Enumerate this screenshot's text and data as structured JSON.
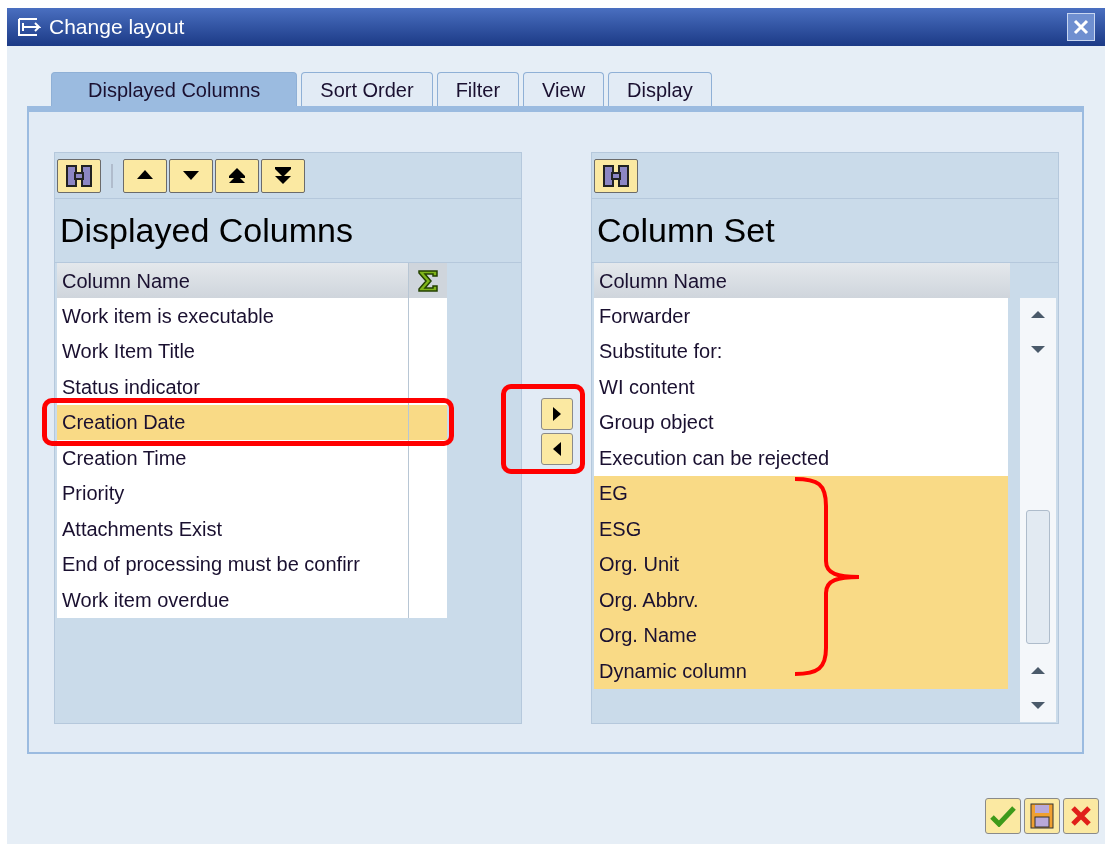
{
  "window": {
    "title": "Change layout"
  },
  "tabs": [
    {
      "label": "Displayed Columns",
      "selected": true
    },
    {
      "label": "Sort Order",
      "selected": false
    },
    {
      "label": "Filter",
      "selected": false
    },
    {
      "label": "View",
      "selected": false
    },
    {
      "label": "Display",
      "selected": false
    }
  ],
  "displayed_columns": {
    "title": "Displayed Columns",
    "header": "Column Name",
    "rows": [
      {
        "label": "Work item is executable",
        "selected": false
      },
      {
        "label": "Work Item Title",
        "selected": false
      },
      {
        "label": "Status indicator",
        "selected": false
      },
      {
        "label": "Creation Date",
        "selected": true
      },
      {
        "label": "Creation Time",
        "selected": false
      },
      {
        "label": "Priority",
        "selected": false
      },
      {
        "label": "Attachments Exist",
        "selected": false
      },
      {
        "label": "End of processing must be confirr",
        "selected": false
      },
      {
        "label": "Work item overdue",
        "selected": false
      }
    ]
  },
  "column_set": {
    "title": "Column Set",
    "header": "Column Name",
    "rows": [
      {
        "label": "Forwarder",
        "selected": false
      },
      {
        "label": "Substitute for:",
        "selected": false
      },
      {
        "label": "WI content",
        "selected": false
      },
      {
        "label": "Group object",
        "selected": false
      },
      {
        "label": "Execution can be rejected",
        "selected": false
      },
      {
        "label": "EG",
        "selected": true
      },
      {
        "label": "ESG",
        "selected": true
      },
      {
        "label": "Org. Unit",
        "selected": true
      },
      {
        "label": "Org. Abbrv.",
        "selected": true
      },
      {
        "label": "Org. Name",
        "selected": true
      },
      {
        "label": "Dynamic column",
        "selected": true
      }
    ]
  }
}
